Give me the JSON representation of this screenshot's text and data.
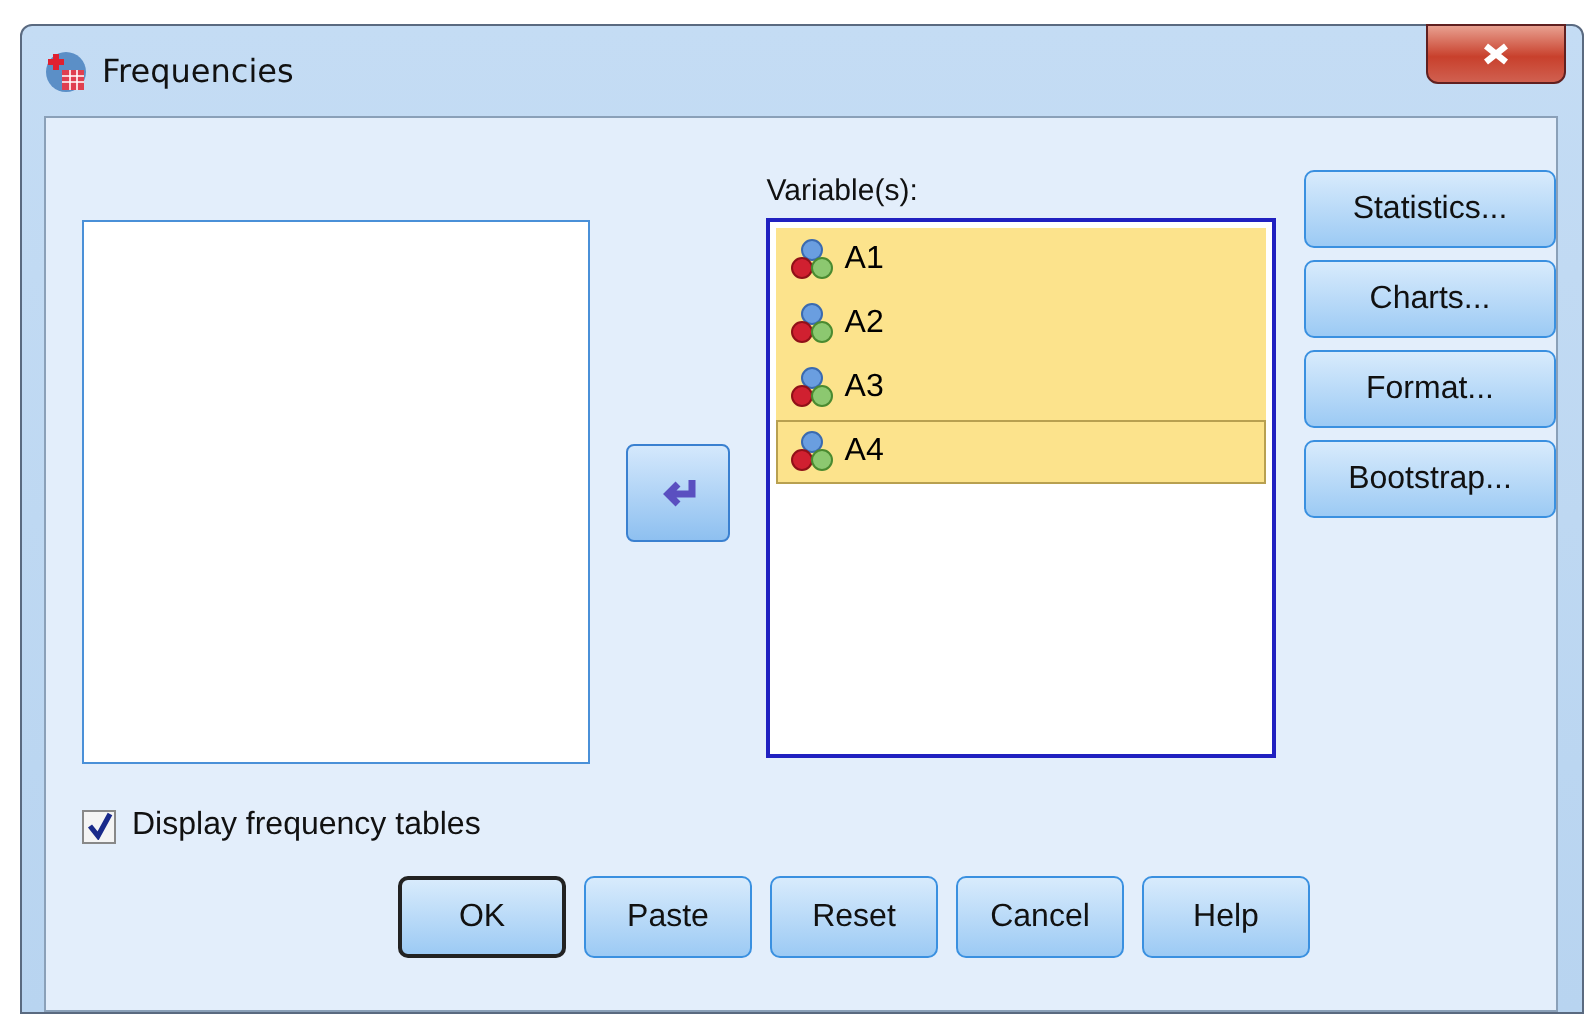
{
  "window": {
    "title": "Frequencies"
  },
  "variables": {
    "label": "Variable(s):",
    "items": [
      {
        "name": "A1",
        "selected": true,
        "focused": false
      },
      {
        "name": "A2",
        "selected": true,
        "focused": false
      },
      {
        "name": "A3",
        "selected": true,
        "focused": false
      },
      {
        "name": "A4",
        "selected": true,
        "focused": true
      }
    ]
  },
  "side_buttons": [
    "Statistics...",
    "Charts...",
    "Format...",
    "Bootstrap..."
  ],
  "display_tables": {
    "label": "Display frequency tables",
    "checked": true
  },
  "buttons": [
    {
      "label": "OK",
      "default": true
    },
    {
      "label": "Paste",
      "default": false
    },
    {
      "label": "Reset",
      "default": false
    },
    {
      "label": "Cancel",
      "default": false
    },
    {
      "label": "Help",
      "default": false
    }
  ]
}
